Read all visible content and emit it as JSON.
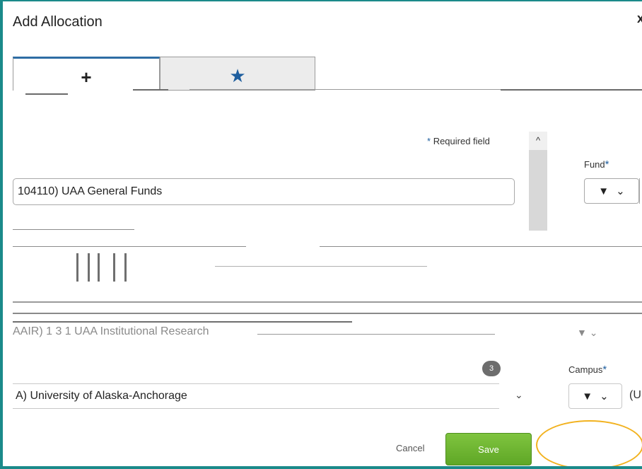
{
  "dialog": {
    "title": "Add Allocation",
    "close_glyph": "x"
  },
  "tabs": [
    {
      "icon": "plus-icon",
      "glyph": "+"
    },
    {
      "icon": "star-icon",
      "glyph": "★"
    }
  ],
  "form": {
    "required_star": "*",
    "required_label": "Required field",
    "scroll_up_glyph": "^",
    "fund": {
      "label": "Fund",
      "star": "*",
      "value": "104110) UAA General Funds",
      "filter_glyph": "▼",
      "chevron_glyph": "⌄"
    },
    "org": {
      "value": "AAIR) 1 3 1 UAA Institutional Research"
    },
    "campus": {
      "badge": "3",
      "label": "Campus",
      "star": "*",
      "value": "A) University of Alaska-Anchorage",
      "code": "(U"
    }
  },
  "footer": {
    "cancel_label": "Cancel",
    "save_label": "Save"
  },
  "colors": {
    "accent": "#1b8a8a",
    "save": "#6cb531",
    "highlight": "#f2b21f",
    "link": "#1e5e9e"
  }
}
